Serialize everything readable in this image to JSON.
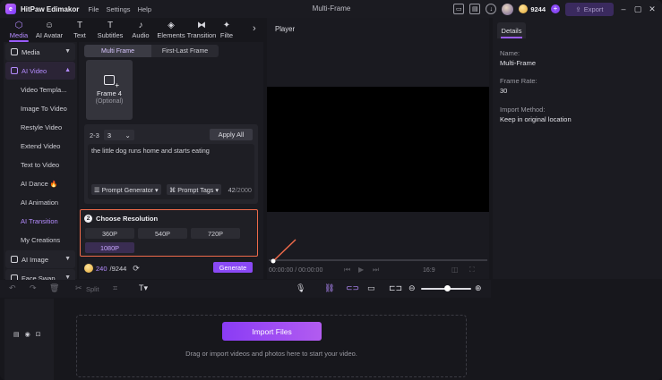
{
  "app": {
    "name": "HitPaw Edimakor",
    "window_title": "Multi-Frame",
    "menu": [
      "File",
      "Settings",
      "Help"
    ],
    "credits": "9244",
    "export_label": "Export"
  },
  "tooltabs": [
    {
      "label": "Media",
      "icon": "media-icon",
      "glyph": "⬡"
    },
    {
      "label": "AI Avatar",
      "icon": "ai-avatar-icon",
      "glyph": "☺"
    },
    {
      "label": "Text",
      "icon": "text-icon",
      "glyph": "T"
    },
    {
      "label": "Subtitles",
      "icon": "subtitles-icon",
      "glyph": "T"
    },
    {
      "label": "Audio",
      "icon": "audio-icon",
      "glyph": "♪"
    },
    {
      "label": "Elements",
      "icon": "elements-icon",
      "glyph": "◈"
    },
    {
      "label": "Transition",
      "icon": "transition-icon",
      "glyph": "⧓"
    },
    {
      "label": "Filte",
      "icon": "filter-icon",
      "glyph": "✦"
    }
  ],
  "sidebar": {
    "media": "Media",
    "ai_video": "AI Video",
    "items": [
      "Video Templa...",
      "Image To Video",
      "Restyle Video",
      "Extend Video",
      "Text to Video",
      "AI Dance",
      "AI Animation",
      "AI Transition",
      "My Creations"
    ],
    "ai_image": "AI Image",
    "face_swap": "Face Swap"
  },
  "panel": {
    "tabs": [
      "Multi Frame",
      "First-Last Frame"
    ],
    "frame_label": "Frame 4",
    "frame_optional": "(Optional)",
    "range_label": "2-3",
    "count_value": "3",
    "apply_all": "Apply All",
    "prompt_text": "the little dog runs home and starts eating",
    "prompt_generator": "Prompt Generator",
    "prompt_tags": "Prompt Tags",
    "char_count": "42",
    "char_max": "/2000",
    "resolution_step": "2",
    "resolution_title": "Choose Resolution",
    "resolutions": [
      "360P",
      "540P",
      "720P",
      "1080P"
    ],
    "selected_resolution": "1080P",
    "credit_cost": "240",
    "credit_total": "/9244",
    "generate": "Generate"
  },
  "player": {
    "title": "Player",
    "time": "00:00:00 / 00:00:00",
    "ratio": "16:9"
  },
  "details": {
    "tab": "Details",
    "name_label": "Name:",
    "name_value": "Multi-Frame",
    "frame_rate_label": "Frame Rate:",
    "frame_rate_value": "30",
    "import_method_label": "Import Method:",
    "import_method_value": "Keep in original location"
  },
  "timeline": {
    "split_label": "Split",
    "import_button": "Import Files",
    "import_hint": "Drag or import videos and photos here to start your video."
  },
  "colors": {
    "accent": "#8a49f5",
    "highlight_border": "#ee6a4a"
  }
}
